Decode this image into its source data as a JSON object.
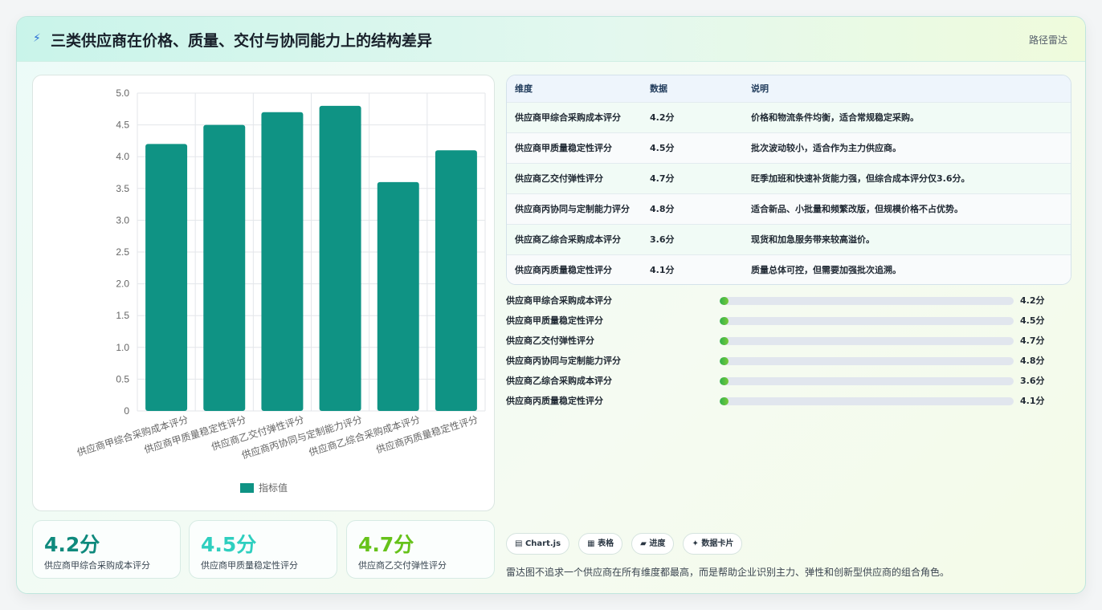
{
  "header": {
    "icon": "lightning-icon",
    "title": "三类供应商在价格、质量、交付与协同能力上的结构差异",
    "tag": "路径雷达"
  },
  "colors": {
    "bar": "#0f9384",
    "kpi_1": "#0f8a7d",
    "kpi_2": "#2ecfbf",
    "kpi_3": "#66c21a",
    "progress": "#3ab34a"
  },
  "chart_data": {
    "type": "bar",
    "categories": [
      "供应商甲综合采购成本评分",
      "供应商甲质量稳定性评分",
      "供应商乙交付弹性评分",
      "供应商丙协同与定制能力评分",
      "供应商乙综合采购成本评分",
      "供应商丙质量稳定性评分"
    ],
    "series": [
      {
        "name": "指标值",
        "values": [
          4.2,
          4.5,
          4.7,
          4.8,
          3.6,
          4.1
        ]
      }
    ],
    "ylim": [
      0,
      5
    ],
    "yticks": [
      "0",
      "0.5",
      "1.0",
      "1.5",
      "2.0",
      "2.5",
      "3.0",
      "3.5",
      "4.0",
      "4.5",
      "5.0"
    ],
    "grid": true,
    "legend": "bottom",
    "title": "",
    "xlabel": "",
    "ylabel": ""
  },
  "kpis": [
    {
      "value": "4.2分",
      "label": "供应商甲综合采购成本评分"
    },
    {
      "value": "4.5分",
      "label": "供应商甲质量稳定性评分"
    },
    {
      "value": "4.7分",
      "label": "供应商乙交付弹性评分"
    }
  ],
  "table": {
    "headers": [
      "维度",
      "数据",
      "说明"
    ],
    "rows": [
      {
        "dim": "供应商甲综合采购成本评分",
        "val": "4.2分",
        "desc": "价格和物流条件均衡，适合常规稳定采购。"
      },
      {
        "dim": "供应商甲质量稳定性评分",
        "val": "4.5分",
        "desc": "批次波动较小，适合作为主力供应商。"
      },
      {
        "dim": "供应商乙交付弹性评分",
        "val": "4.7分",
        "desc": "旺季加班和快速补货能力强，但综合成本评分仅3.6分。"
      },
      {
        "dim": "供应商丙协同与定制能力评分",
        "val": "4.8分",
        "desc": "适合新品、小批量和频繁改版，但规模价格不占优势。"
      },
      {
        "dim": "供应商乙综合采购成本评分",
        "val": "3.6分",
        "desc": "现货和加急服务带来较高溢价。"
      },
      {
        "dim": "供应商丙质量稳定性评分",
        "val": "4.1分",
        "desc": "质量总体可控，但需要加强批次追溯。"
      }
    ]
  },
  "progress": [
    {
      "label": "供应商甲综合采购成本评分",
      "value": "4.2分",
      "fill_percent": 3
    },
    {
      "label": "供应商甲质量稳定性评分",
      "value": "4.5分",
      "fill_percent": 3
    },
    {
      "label": "供应商乙交付弹性评分",
      "value": "4.7分",
      "fill_percent": 3
    },
    {
      "label": "供应商丙协同与定制能力评分",
      "value": "4.8分",
      "fill_percent": 3
    },
    {
      "label": "供应商乙综合采购成本评分",
      "value": "3.6分",
      "fill_percent": 3
    },
    {
      "label": "供应商丙质量稳定性评分",
      "value": "4.1分",
      "fill_percent": 3
    }
  ],
  "badges": [
    {
      "icon": "chart-icon",
      "glyph": "▤",
      "label": "Chart.js"
    },
    {
      "icon": "table-icon",
      "glyph": "▦",
      "label": "表格"
    },
    {
      "icon": "progress-icon",
      "glyph": "▰",
      "label": "进度"
    },
    {
      "icon": "sparkle-icon",
      "glyph": "✦",
      "label": "数据卡片"
    }
  ],
  "note": "雷达图不追求一个供应商在所有维度都最高，而是帮助企业识别主力、弹性和创新型供应商的组合角色。"
}
